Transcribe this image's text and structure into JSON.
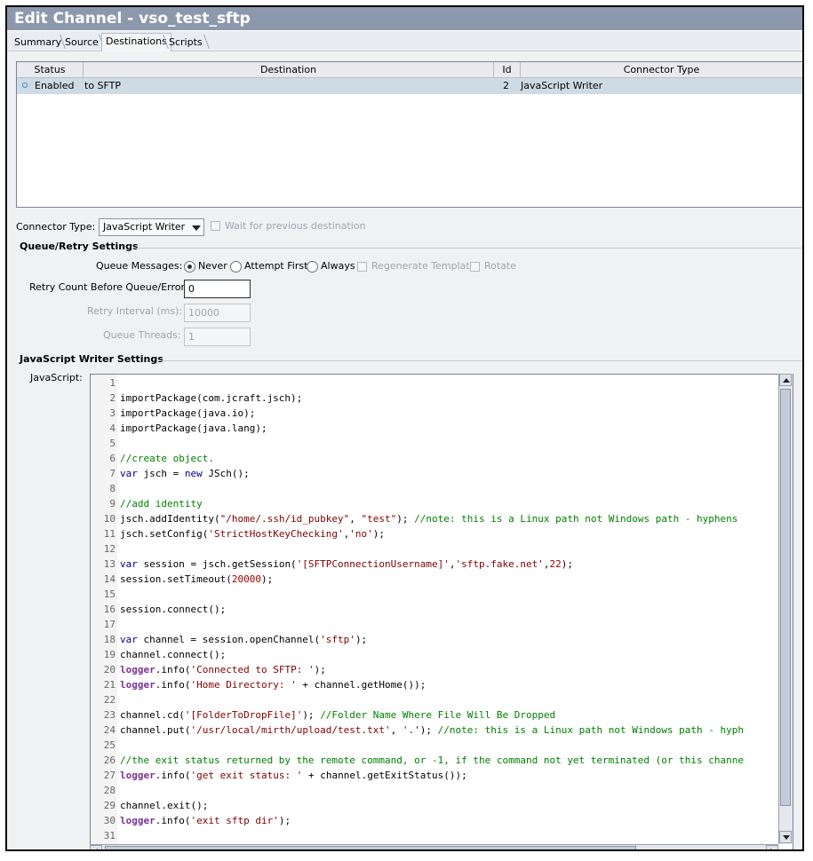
{
  "window": {
    "title": "Edit Channel - vso_test_sftp"
  },
  "tabs": [
    {
      "label": "Summary"
    },
    {
      "label": "Source"
    },
    {
      "label": "Destinations"
    },
    {
      "label": "Scripts"
    }
  ],
  "destinations_table": {
    "columns": [
      "Status",
      "Destination",
      "Id",
      "Connector Type"
    ],
    "rows": [
      {
        "status": "Enabled",
        "destination": "to SFTP",
        "id": "2",
        "connector_type": "JavaScript Writer"
      }
    ]
  },
  "connector": {
    "label": "Connector Type:",
    "value": "JavaScript Writer",
    "wait_label": "Wait for previous destination"
  },
  "queue": {
    "section_title": "Queue/Retry Settings",
    "queue_messages_label": "Queue Messages:",
    "options": [
      "Never",
      "Attempt First",
      "Always"
    ],
    "selected": "Never",
    "regenerate_label": "Regenerate Template",
    "rotate_label": "Rotate",
    "retry_count_label": "Retry Count Before Queue/Error:",
    "retry_count_value": "0",
    "retry_interval_label": "Retry Interval (ms):",
    "retry_interval_value": "10000",
    "queue_threads_label": "Queue Threads:",
    "queue_threads_value": "1"
  },
  "js_writer": {
    "section_title": "JavaScript Writer Settings",
    "javascript_label": "JavaScript:"
  },
  "code_lines": [
    "",
    "importPackage(com.jcraft.jsch);",
    "importPackage(java.io);",
    "importPackage(java.lang);",
    "",
    "//create object.",
    "var jsch = new JSch();",
    "",
    "//add identity",
    "jsch.addIdentity(\"/home/.ssh/id_pubkey\", \"test\"); //note: this is a Linux path not Windows path - hyphens",
    "jsch.setConfig('StrictHostKeyChecking','no');",
    "",
    "var session = jsch.getSession('[SFTPConnectionUsername]','sftp.fake.net',22);",
    "session.setTimeout(20000);",
    "",
    "session.connect();",
    "",
    "var channel = session.openChannel('sftp');",
    "channel.connect();",
    "logger.info('Connected to SFTP: ');",
    "logger.info('Home Directory: ' + channel.getHome());",
    "",
    "channel.cd('[FolderToDropFile]'); //Folder Name Where File Will Be Dropped",
    "channel.put('/usr/local/mirth/upload/test.txt', '.'); //note: this is a Linux path not Windows path - hyph",
    "",
    "//the exit status returned by the remote command, or -1, if the command not yet terminated (or this channe",
    "logger.info('get exit status: ' + channel.getExitStatus());",
    "",
    "channel.exit();",
    "logger.info('exit sftp dir');",
    ""
  ],
  "colors": {
    "titlebar": "#8c99ad",
    "selected_row": "#cfdbe4",
    "keyword": "#000080",
    "comment": "#008000",
    "string": "#800000",
    "logger": "#7b3294"
  }
}
